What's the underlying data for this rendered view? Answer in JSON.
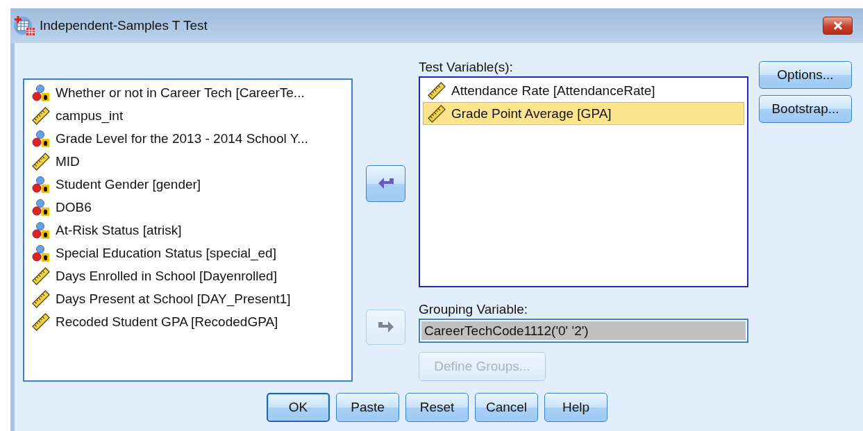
{
  "window": {
    "title": "Independent-Samples T Test"
  },
  "variables": [
    {
      "name": "Whether or not in Career Tech [CareerTe...",
      "kind": "nominal",
      "selected": false
    },
    {
      "name": "campus_int",
      "kind": "scale",
      "selected": false
    },
    {
      "name": "Grade Level for the 2013 - 2014 School Y...",
      "kind": "nominal",
      "selected": false
    },
    {
      "name": "MID",
      "kind": "scale",
      "selected": false
    },
    {
      "name": "Student Gender [gender]",
      "kind": "nominal",
      "selected": false
    },
    {
      "name": "DOB6",
      "kind": "nominal",
      "selected": false
    },
    {
      "name": "At-Risk Status [atrisk]",
      "kind": "nominal",
      "selected": false
    },
    {
      "name": "Special Education Status [special_ed]",
      "kind": "nominal",
      "selected": false
    },
    {
      "name": "Days Enrolled in School [Dayenrolled]",
      "kind": "scale",
      "selected": false
    },
    {
      "name": "Days Present at School [DAY_Present1]",
      "kind": "scale",
      "selected": false
    },
    {
      "name": "Recoded Student GPA [RecodedGPA]",
      "kind": "scale",
      "selected": false
    }
  ],
  "move_test_button": {
    "disabled": false
  },
  "move_grouping_button": {
    "disabled": true
  },
  "test_variables": {
    "label": "Test Variable(s):",
    "items": [
      {
        "name": "Attendance Rate [AttendanceRate]",
        "kind": "scale",
        "selected": false
      },
      {
        "name": "Grade Point Average [GPA]",
        "kind": "scale",
        "selected": true
      }
    ]
  },
  "grouping_variable": {
    "label": "Grouping Variable:",
    "value": "CareerTechCode1112('0' '2')"
  },
  "define_groups_button": {
    "label": "Define Groups...",
    "disabled": true
  },
  "side_buttons": [
    {
      "label": "Options...",
      "disabled": false
    },
    {
      "label": "Bootstrap...",
      "disabled": false
    }
  ],
  "bottom_buttons": [
    {
      "label": "OK",
      "default": true
    },
    {
      "label": "Paste",
      "default": false
    },
    {
      "label": "Reset",
      "default": false
    },
    {
      "label": "Cancel",
      "default": false
    },
    {
      "label": "Help",
      "default": false
    }
  ]
}
